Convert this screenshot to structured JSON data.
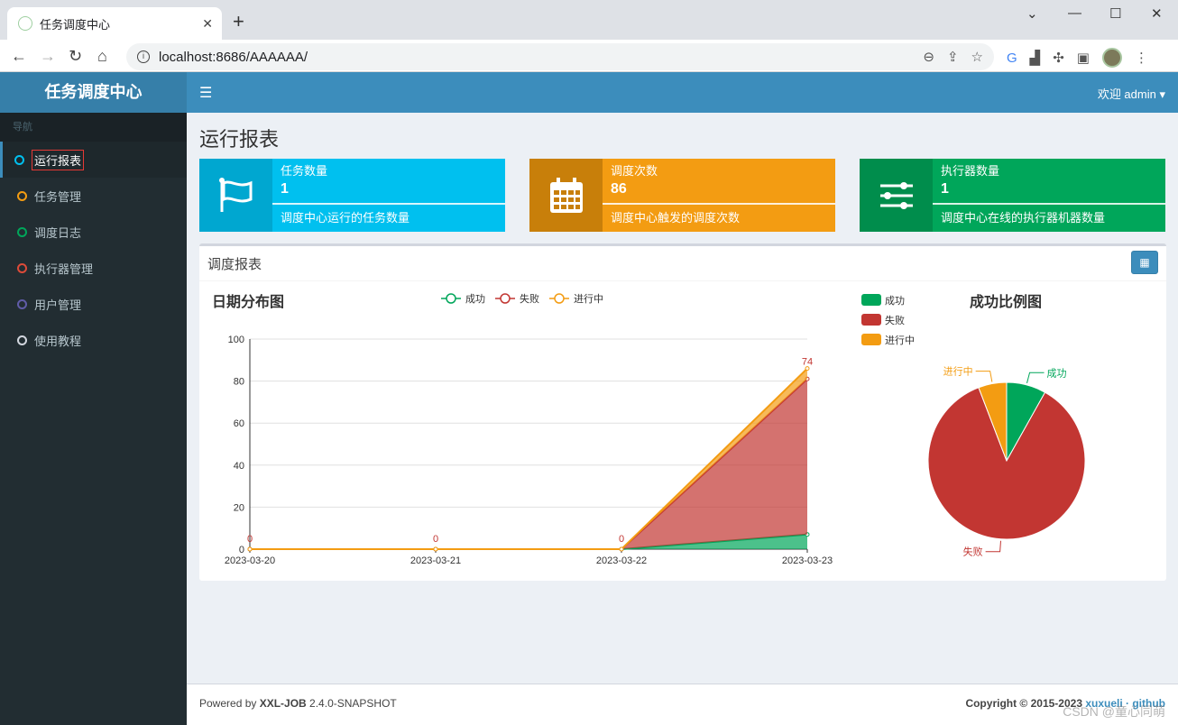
{
  "browser": {
    "tab_title": "任务调度中心",
    "url": "localhost:8686/AAAAAA/"
  },
  "app": {
    "logo": "任务调度中心",
    "nav_header": "导航",
    "menu": [
      {
        "label": "运行报表",
        "color": "#00c0ef",
        "active": true
      },
      {
        "label": "任务管理",
        "color": "#f39c12"
      },
      {
        "label": "调度日志",
        "color": "#00a65a"
      },
      {
        "label": "执行器管理",
        "color": "#dd4b39"
      },
      {
        "label": "用户管理",
        "color": "#605ca8"
      },
      {
        "label": "使用教程",
        "color": "#d2d6de"
      }
    ],
    "welcome": "欢迎 admin"
  },
  "page": {
    "title": "运行报表",
    "cards": [
      {
        "label": "任务数量",
        "value": "1",
        "desc": "调度中心运行的任务数量",
        "color": "#00c0ef",
        "icon_bg": "#00a7d0",
        "icon": "flag-icon"
      },
      {
        "label": "调度次数",
        "value": "86",
        "desc": "调度中心触发的调度次数",
        "color": "#f39c12",
        "icon_bg": "#c87f0a",
        "icon": "calendar-icon"
      },
      {
        "label": "执行器数量",
        "value": "1",
        "desc": "调度中心在线的执行器机器数量",
        "color": "#00a65a",
        "icon_bg": "#008d4c",
        "icon": "sliders-icon"
      }
    ],
    "report_title": "调度报表"
  },
  "chart_data": [
    {
      "type": "area",
      "title": "日期分布图",
      "x": [
        "2023-03-20",
        "2023-03-21",
        "2023-03-22",
        "2023-03-23"
      ],
      "series": [
        {
          "name": "成功",
          "values": [
            0,
            0,
            0,
            7
          ],
          "color": "#00a65a"
        },
        {
          "name": "失败",
          "values": [
            0,
            0,
            0,
            74
          ],
          "color": "#c23632"
        },
        {
          "name": "进行中",
          "values": [
            0,
            0,
            0,
            5
          ],
          "color": "#f39c12"
        }
      ],
      "data_labels": [
        "0",
        "0",
        "0",
        "74"
      ],
      "ylim": [
        0,
        100
      ],
      "yticks": [
        0,
        20,
        40,
        60,
        80,
        100
      ],
      "legend": "top-center"
    },
    {
      "type": "pie",
      "title": "成功比例图",
      "categories": [
        "成功",
        "失败",
        "进行中"
      ],
      "values": [
        7,
        74,
        5
      ],
      "colors": [
        "#00a65a",
        "#c23632",
        "#f39c12"
      ],
      "legend": "top-left"
    }
  ],
  "footer": {
    "powered_prefix": "Powered by ",
    "product": "XXL-JOB",
    "version": " 2.4.0-SNAPSHOT",
    "copyright": "Copyright © 2015-2023 ",
    "links": "xuxueli · github",
    "watermark": "CSDN @童心同萌"
  }
}
